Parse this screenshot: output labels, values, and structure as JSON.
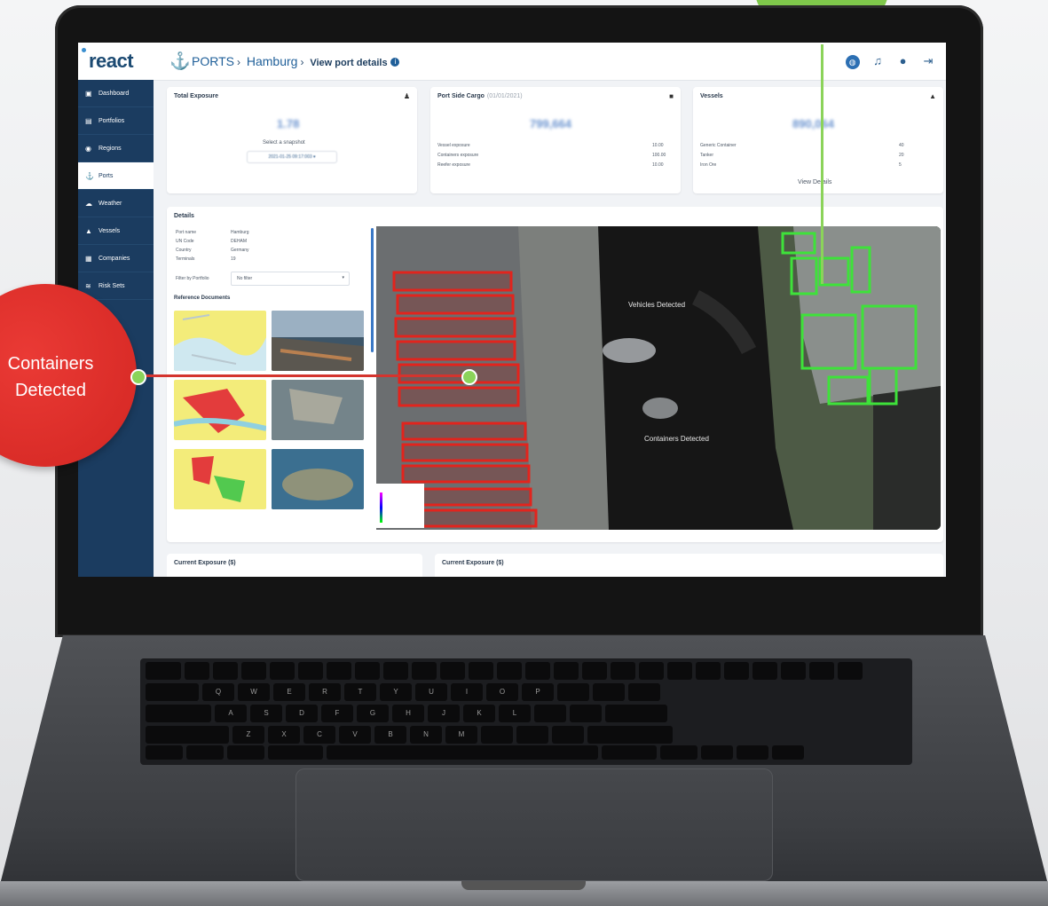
{
  "app": {
    "logo": "react",
    "breadcrumb": {
      "section": "PORTS",
      "port": "Hamburg",
      "page": "View port details"
    }
  },
  "topbar_icons": [
    "globe-icon",
    "bell-icon",
    "user-icon",
    "logout-icon"
  ],
  "sidebar": {
    "items": [
      {
        "label": "Dashboard",
        "icon": "dashboard-icon"
      },
      {
        "label": "Portfolios",
        "icon": "portfolio-icon"
      },
      {
        "label": "Regions",
        "icon": "region-pin-icon"
      },
      {
        "label": "Ports",
        "icon": "anchor-icon",
        "active": true
      },
      {
        "label": "Weather",
        "icon": "weather-icon"
      },
      {
        "label": "Vessels",
        "icon": "vessel-icon"
      },
      {
        "label": "Companies",
        "icon": "company-icon"
      },
      {
        "label": "Risk Sets",
        "icon": "risk-icon"
      }
    ]
  },
  "cards": {
    "total_exposure": {
      "title": "Total Exposure",
      "value": "1.78",
      "hint": "Select a snapshot",
      "snapshot": "2021-01-25 09:17:003"
    },
    "port_side_cargo": {
      "title": "Port Side Cargo",
      "subtitle": "(01/01/2021)",
      "value": "799,664",
      "rows": [
        {
          "label": "Vessel exposure",
          "value": "10.00"
        },
        {
          "label": "Containers exposure",
          "value": "100.00"
        },
        {
          "label": "Reefer exposure",
          "value": "10.00"
        }
      ]
    },
    "vessels": {
      "title": "Vessels",
      "value": "890,064",
      "link": "View Details",
      "rows": [
        {
          "label": "Generic Container",
          "value": "40"
        },
        {
          "label": "Tanker",
          "value": "20"
        },
        {
          "label": "Iron Ore",
          "value": "5"
        }
      ]
    }
  },
  "details": {
    "title": "Details",
    "fields": [
      {
        "label": "Port name",
        "value": "Hamburg"
      },
      {
        "label": "UN Code",
        "value": "DEHAM"
      },
      {
        "label": "Country",
        "value": "Germany"
      },
      {
        "label": "Terminals",
        "value": "19"
      }
    ],
    "filter_label": "Filter by Portfolio",
    "filter_value": "No filter",
    "ref_docs_title": "Reference Documents",
    "map_annotations": {
      "vehicles": "Vehicles Detected",
      "containers": "Containers Detected"
    }
  },
  "bottom_cards": [
    {
      "title": "Current Exposure ($)"
    },
    {
      "title": "Current Exposure ($)"
    }
  ],
  "callouts": {
    "red": "Containers Detected"
  },
  "colors": {
    "sidebar": "#1b3c60",
    "brand": "#1f5f99",
    "red_callout": "#d32622",
    "green_callout": "#7fc84b"
  }
}
